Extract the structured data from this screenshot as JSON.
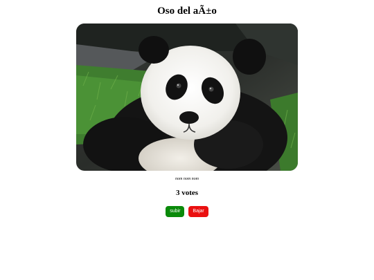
{
  "page": {
    "title": "Oso del aÃ±o"
  },
  "photo": {
    "caption": "nom nom nom",
    "icon": "panda-photo"
  },
  "votes": {
    "label": "3 votes",
    "count": 3
  },
  "buttons": {
    "up_label": "subir",
    "down_label": "Bajar"
  },
  "colors": {
    "up_button": "#0a8a0a",
    "down_button": "#ea1010"
  }
}
